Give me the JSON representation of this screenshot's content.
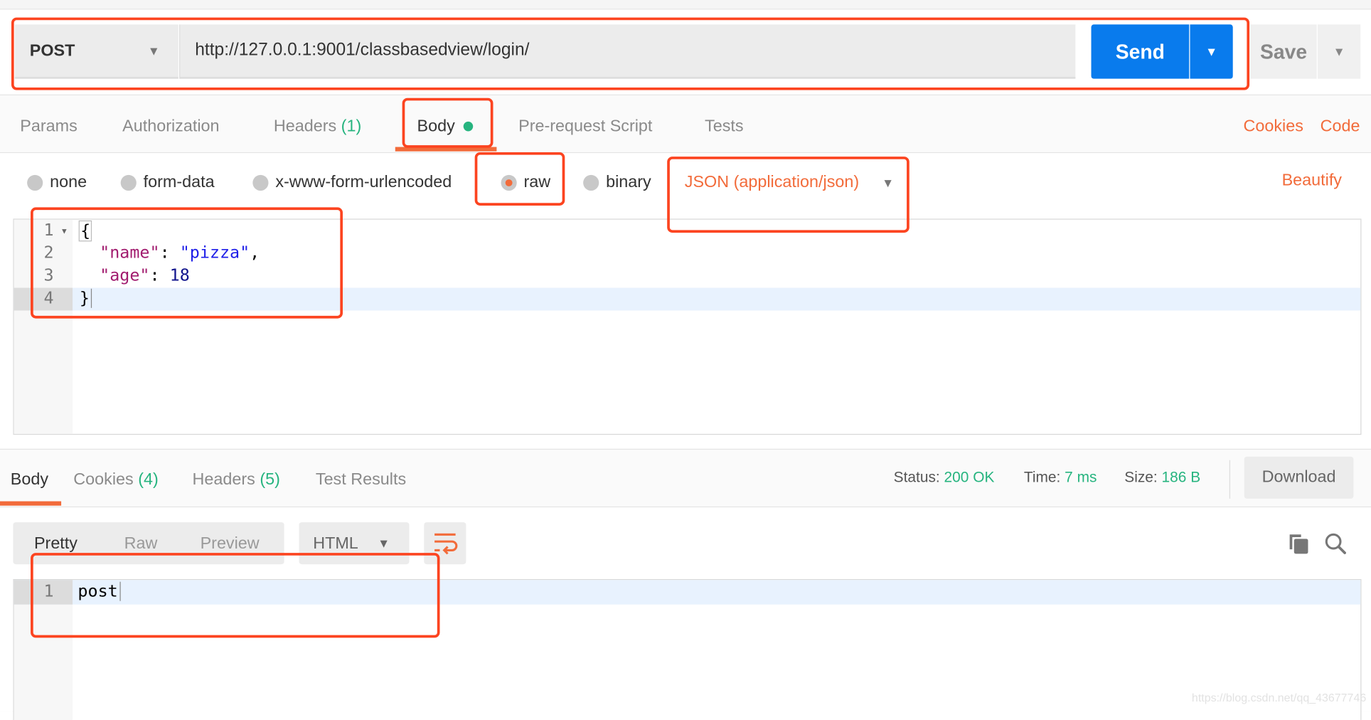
{
  "request": {
    "method": "POST",
    "url": "http://127.0.0.1:9001/classbasedview/login/",
    "send_label": "Send",
    "save_label": "Save"
  },
  "request_tabs": [
    {
      "label": "Params"
    },
    {
      "label": "Authorization"
    },
    {
      "label": "Headers",
      "count": "(1)"
    },
    {
      "label": "Body",
      "active": true
    },
    {
      "label": "Pre-request Script"
    },
    {
      "label": "Tests"
    }
  ],
  "links": {
    "cookies": "Cookies",
    "code": "Code",
    "beautify": "Beautify"
  },
  "body_types": [
    {
      "label": "none"
    },
    {
      "label": "form-data"
    },
    {
      "label": "x-www-form-urlencoded"
    },
    {
      "label": "raw",
      "selected": true
    },
    {
      "label": "binary"
    }
  ],
  "content_type": "JSON (application/json)",
  "request_body": {
    "line_numbers": [
      "1",
      "2",
      "3",
      "4"
    ],
    "lines": {
      "l1": "{",
      "name_key": "\"name\"",
      "colon": ": ",
      "name_val": "\"pizza\"",
      "comma": ",",
      "age_key": "\"age\"",
      "age_val": "18",
      "l4": "}"
    }
  },
  "response_tabs": [
    {
      "label": "Body",
      "active": true
    },
    {
      "label": "Cookies",
      "count": "(4)"
    },
    {
      "label": "Headers",
      "count": "(5)"
    },
    {
      "label": "Test Results"
    }
  ],
  "status": {
    "status_label": "Status:",
    "status_value": "200 OK",
    "time_label": "Time:",
    "time_value": "7 ms",
    "size_label": "Size:",
    "size_value": "186 B",
    "download_label": "Download"
  },
  "view_modes": [
    "Pretty",
    "Raw",
    "Preview"
  ],
  "response_format": "HTML",
  "response_body": {
    "line_numbers": [
      "1"
    ],
    "lines": [
      "post"
    ]
  },
  "watermark": "https://blog.csdn.net/qq_43677746",
  "colors": {
    "accent": "#f26b3a",
    "send": "#097bed",
    "success": "#26b47f",
    "annotation": "#fc4420"
  }
}
